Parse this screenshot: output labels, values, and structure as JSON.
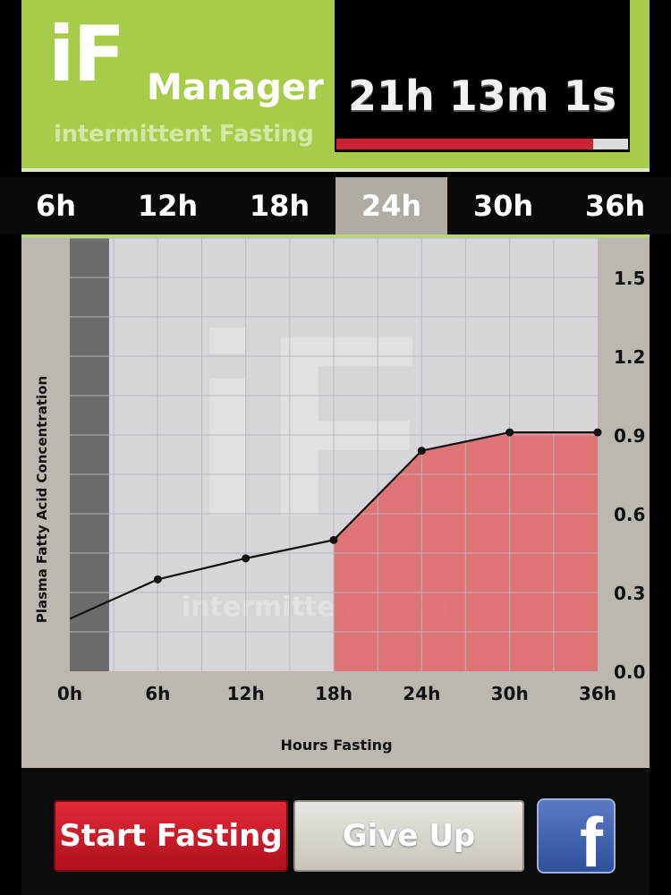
{
  "header": {
    "logo_main": "iF",
    "logo_word": "Manager",
    "logo_subtitle": "intermittent Fasting",
    "timer": "21h 13m 1s",
    "timer_progress": 0.88
  },
  "tabs": [
    {
      "label": "6h",
      "active": false
    },
    {
      "label": "12h",
      "active": false
    },
    {
      "label": "18h",
      "active": false
    },
    {
      "label": "24h",
      "active": true
    },
    {
      "label": "30h",
      "active": false
    },
    {
      "label": "36h",
      "active": false
    }
  ],
  "colors": {
    "accent_green": "#a6cc4a",
    "fill_red": "#e06b6f",
    "start_red": "#cc1f2c"
  },
  "chart_data": {
    "type": "line",
    "ylabel": "Plasma Fatty Acid Concentration",
    "xlabel": "Hours Fasting",
    "x": [
      0,
      6,
      12,
      18,
      24,
      30,
      36
    ],
    "x_tick_labels": [
      "0h",
      "6h",
      "12h",
      "18h",
      "24h",
      "30h",
      "36h"
    ],
    "values": [
      0.2,
      0.35,
      0.43,
      0.5,
      0.84,
      0.91,
      0.91
    ],
    "ylim": [
      0,
      1.65
    ],
    "y_ticks": [
      "0.0",
      "0.3",
      "0.6",
      "0.9",
      "1.2",
      "1.5"
    ],
    "highlight_from_x": 18,
    "watermark": "intermittent Fasting",
    "grid": true,
    "y_axis_side": "right"
  },
  "buttons": {
    "start": "Start Fasting",
    "give_up": "Give Up",
    "facebook_glyph": "f"
  }
}
